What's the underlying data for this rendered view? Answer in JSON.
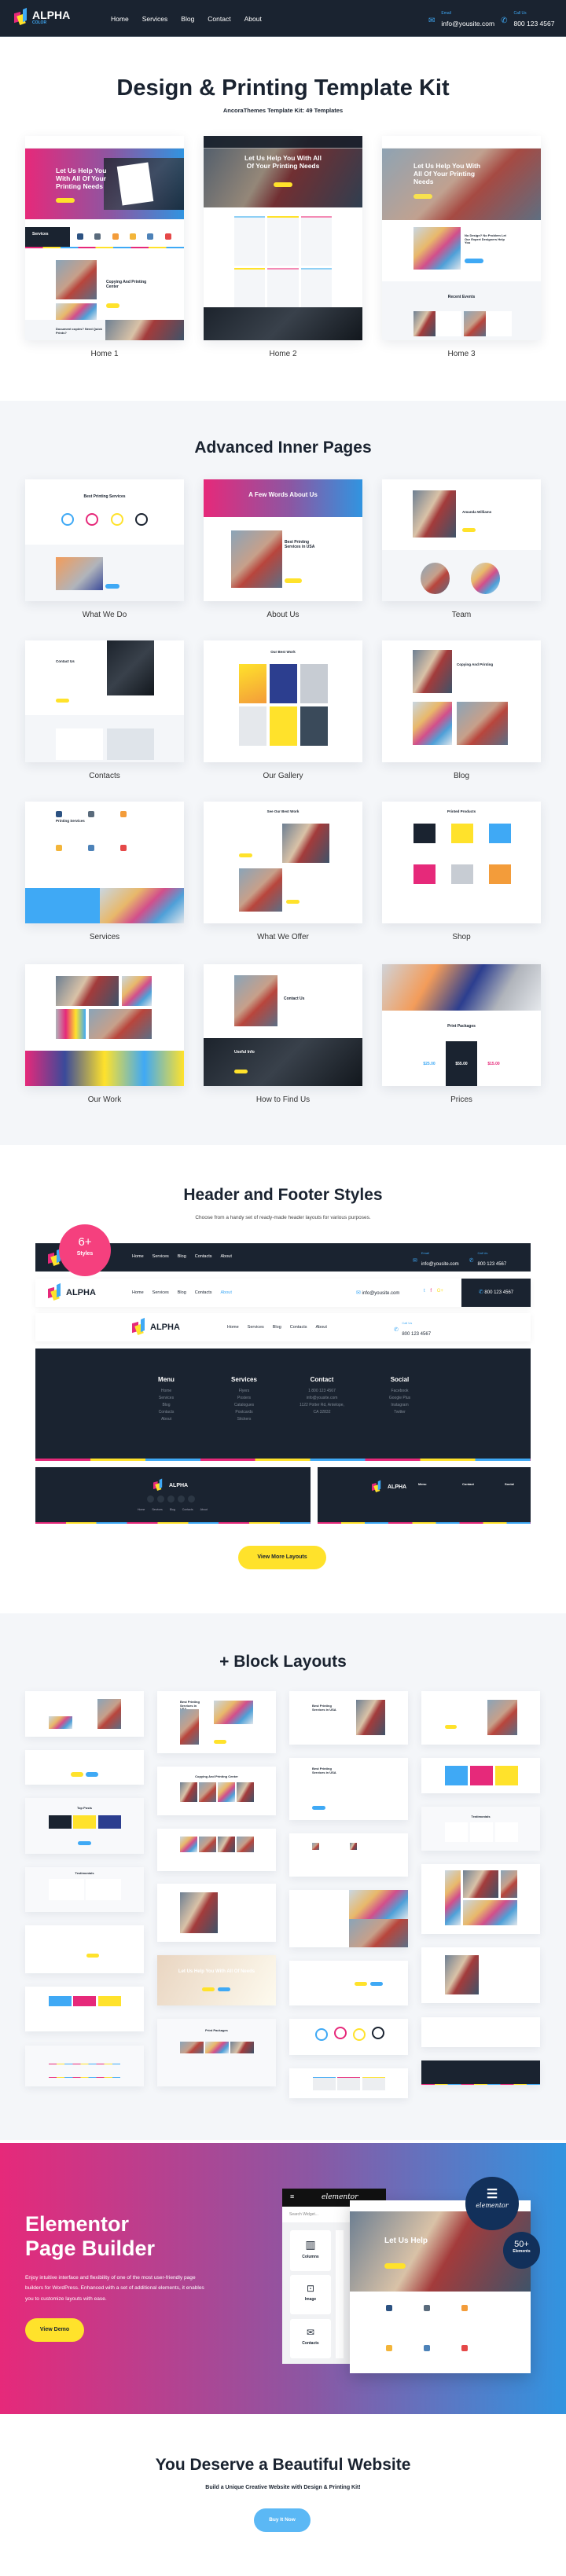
{
  "colors": {
    "navy": "#1a2330",
    "pink": "#e6297a",
    "yellow": "#ffe22b",
    "blue": "#3fa9f5",
    "bg_light": "#f4f6f9"
  },
  "nav": {
    "logo_text": "ALPHA",
    "logo_sub": "COLOR",
    "menu": [
      "Home",
      "Services",
      "Blog",
      "Contact",
      "About"
    ],
    "email_label": "Email",
    "email": "info@yousite.com",
    "call_label": "Call Us",
    "phone": "800 123 4567"
  },
  "intro": {
    "title": "Design & Printing Template Kit",
    "subtitle": "AncoraThemes Template Kit: 49 Templates",
    "homes": [
      {
        "label": "Home 1",
        "headline": "Let Us Help You With All Of Your Printing Needs",
        "section": "Services",
        "feature": "Copying And Printing Center",
        "bottom": "Document copies? Need Quick Prints?"
      },
      {
        "label": "Home 2",
        "headline": "Let Us Help You With All Of Your Printing Needs"
      },
      {
        "label": "Home 3",
        "headline": "Let Us Help You With All Of Your Printing Needs",
        "feature": "No Design? No Problem Let Our Expert Designers Help You",
        "events": "Recent Events"
      }
    ]
  },
  "inner": {
    "title": "Advanced Inner Pages",
    "pages": [
      {
        "label": "What We Do",
        "headline": "Best Printing Services"
      },
      {
        "label": "About Us",
        "headline": "A Few Words About Us"
      },
      {
        "label": "Team",
        "headline": "Amanda Williams"
      },
      {
        "label": "Contacts",
        "headline": "Contact Us"
      },
      {
        "label": "Our Gallery",
        "headline": "Our Best Work"
      },
      {
        "label": "Blog",
        "headline": "Copying And Printing"
      },
      {
        "label": "Services",
        "headline": "Printing Services"
      },
      {
        "label": "What We Offer",
        "headline": "See Our Best Work"
      },
      {
        "label": "Shop",
        "headline": "Printed Products"
      },
      {
        "label": "Our Work",
        "headline": ""
      },
      {
        "label": "How to Find Us",
        "headline": "Contact Us",
        "secondary": "Useful Info"
      },
      {
        "label": "Prices",
        "headline": "Print Packages",
        "prices": [
          "$25.00",
          "$55.00",
          "$15.00"
        ]
      }
    ]
  },
  "headers": {
    "title": "Header and Footer Styles",
    "subtitle": "Choose from a handy set of ready-made header layouts for various purposes.",
    "badge_number": "6+",
    "badge_label": "Styles",
    "menu": [
      "Home",
      "Services",
      "Blog",
      "Contacts",
      "About"
    ],
    "email": "info@yousite.com",
    "phone": "800 123 4567",
    "call_label": "Call Us",
    "email_label": "Email",
    "footer_columns": [
      {
        "title": "Menu",
        "items": [
          "Home",
          "Services",
          "Blog",
          "Contacts",
          "About"
        ]
      },
      {
        "title": "Services",
        "items": [
          "Flyers",
          "Posters",
          "Catalogues",
          "Postcards",
          "Stickers"
        ]
      },
      {
        "title": "Contact",
        "items": [
          "1 800 123 4567",
          "info@yousite.com",
          "1122 Potter Rd, Antelope,",
          "CA 32832"
        ]
      },
      {
        "title": "Social",
        "items": [
          "Facebook",
          "Google Plus",
          "Instagram",
          "Twitter"
        ]
      }
    ],
    "small_footer_menu": [
      "Home",
      "Services",
      "Blog",
      "Contacts",
      "About"
    ],
    "view_more": "View More Layouts"
  },
  "blocks": {
    "title": "+ Block Layouts",
    "labels": [
      "Best Printing Services in USA",
      "Copying And Printing Center",
      "Top Posts",
      "Testimonials",
      "Let Us Help With All",
      "Let Us Help You With All Of Needs",
      "Print Packages"
    ]
  },
  "elementor": {
    "title_line1": "Elementor",
    "title_line2": "Page Builder",
    "text": "Enjoy intuitive interface and flexibility of one of the most user-friendly page builders for WordPress. Enhanced with a set of additional elements, it enables you to customize layouts with ease.",
    "button": "View Demo",
    "panel_brand": "elementor",
    "search_placeholder": "Search Widget...",
    "widgets": [
      "Columns",
      "Image",
      "Contacts"
    ],
    "hero": "Let Us Help",
    "badge_brand": "elementor",
    "elements_number": "50+",
    "elements_label": "Elements"
  },
  "cta": {
    "title": "You Deserve a Beautiful Website",
    "subtitle": "Build a Unique Creative Website with Design & Printing Kit!",
    "button": "Buy It Now"
  }
}
